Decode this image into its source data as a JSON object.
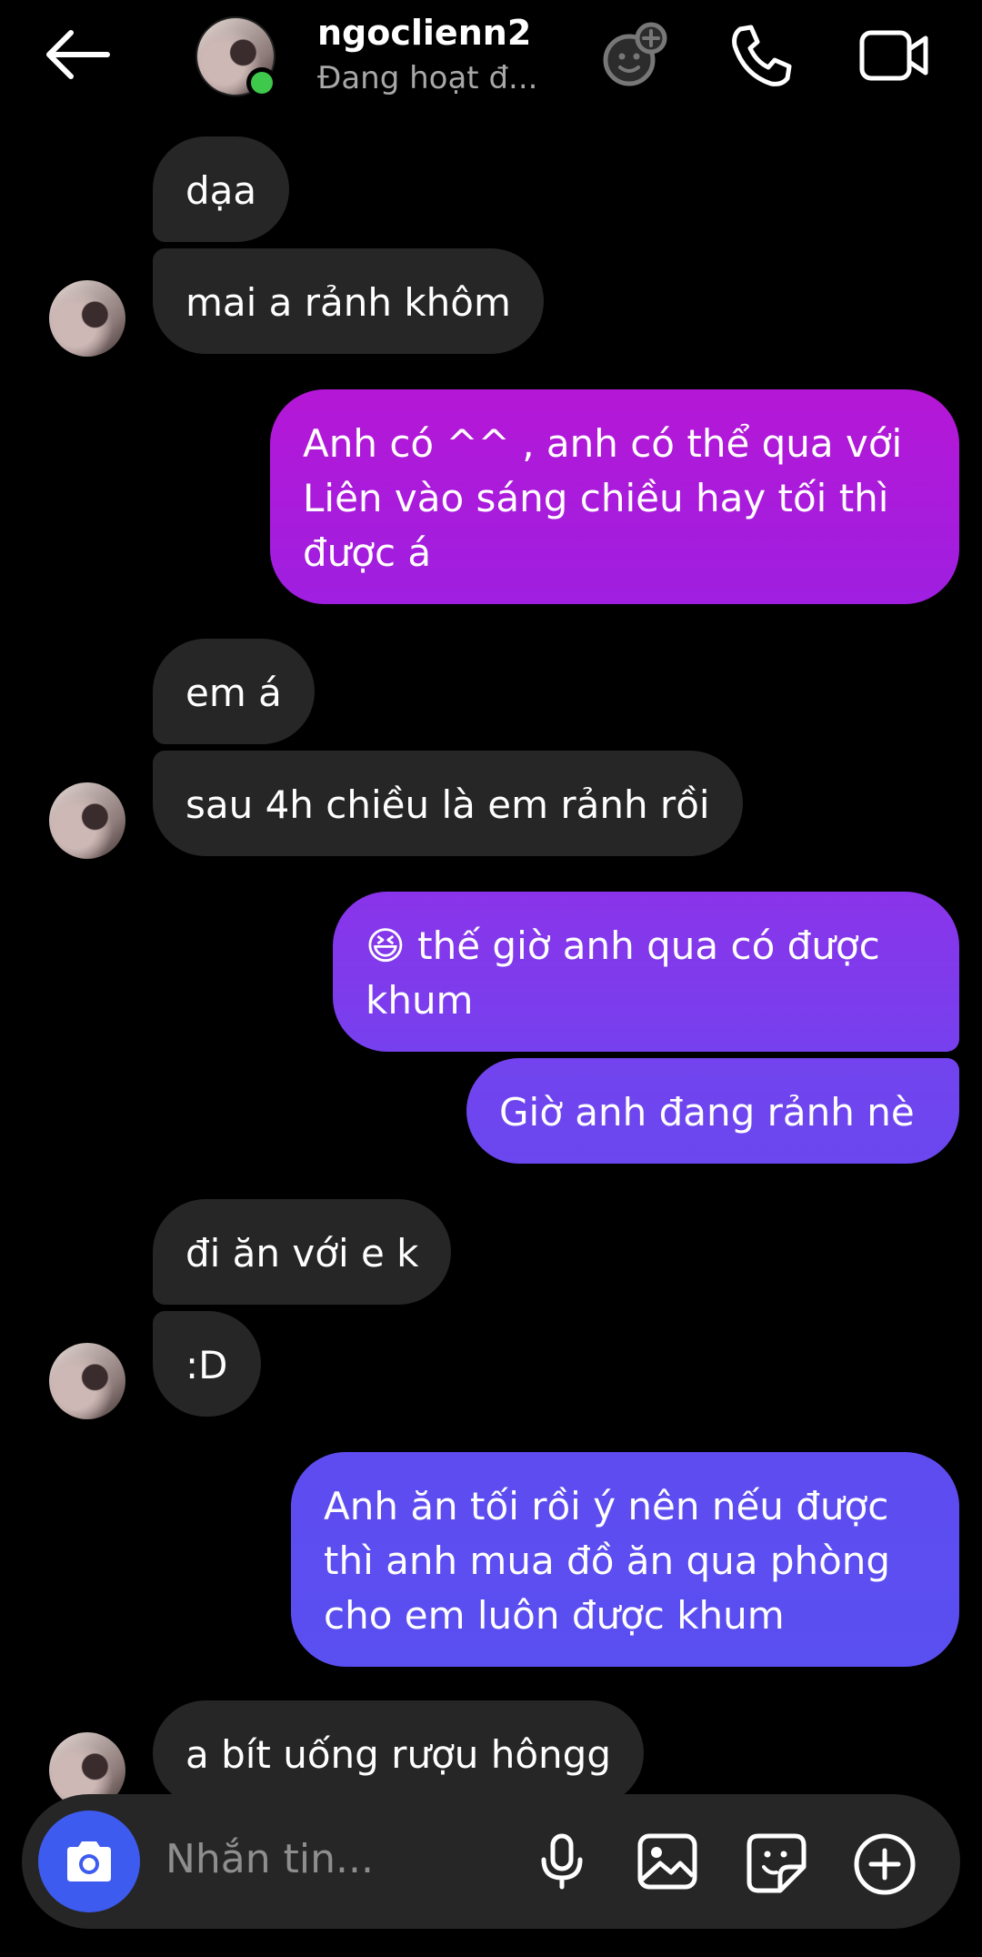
{
  "header": {
    "name": "ngoclienn2",
    "status": "Đang hoạt đ...",
    "icons": [
      "back-arrow-icon",
      "effects-icon",
      "phone-icon",
      "video-camera-icon"
    ]
  },
  "messages": [
    {
      "id": "m1",
      "sender": "them",
      "text": "dạa"
    },
    {
      "id": "m2",
      "sender": "them",
      "text": "mai a rảnh khôm"
    },
    {
      "id": "m3",
      "sender": "me",
      "lines": [
        "Anh có ^^ , anh có thể qua với",
        "Liên vào sáng chiều hay tối thì",
        "được á"
      ]
    },
    {
      "id": "m4",
      "sender": "them",
      "text": "em á"
    },
    {
      "id": "m5",
      "sender": "them",
      "text": "sau 4h chiều là em rảnh rồi"
    },
    {
      "id": "m6",
      "sender": "me",
      "emoji": "😆",
      "lines": [
        " thế giờ anh qua có được",
        "khum"
      ]
    },
    {
      "id": "m7",
      "sender": "me",
      "text": "Giờ anh đang rảnh nè"
    },
    {
      "id": "m8",
      "sender": "them",
      "text": "đi ăn với e k"
    },
    {
      "id": "m9",
      "sender": "them",
      "text": ":D"
    },
    {
      "id": "m10",
      "sender": "me",
      "lines": [
        "Anh ăn tối rồi ý nên nếu được",
        "thì anh mua đồ ăn qua phòng",
        "cho em luôn được khum"
      ]
    },
    {
      "id": "m11",
      "sender": "them",
      "text": "a bít uống rượu hôngg"
    }
  ],
  "composer": {
    "placeholder": "Nhắn tin...",
    "icons": [
      "camera-icon",
      "microphone-icon",
      "gallery-icon",
      "sticker-icon",
      "add-icon"
    ]
  },
  "colors": {
    "background": "#000000",
    "incoming_bubble": "#262626",
    "outgoing_gradient_top": "#b517d6",
    "outgoing_gradient_bottom": "#5a4ff0",
    "online": "#3ec84c",
    "camera_button": "#3e5bf0"
  }
}
